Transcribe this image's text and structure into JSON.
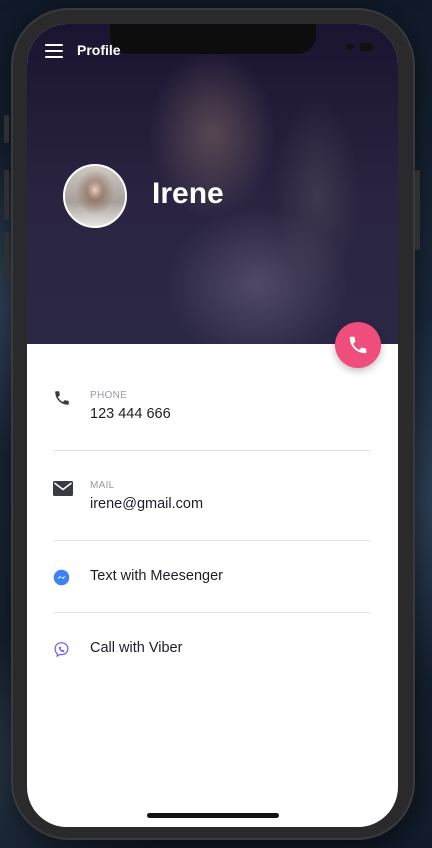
{
  "header": {
    "title": "Profile",
    "name": "Irene"
  },
  "contacts": {
    "phone": {
      "label": "PHONE",
      "value": "123 444 666",
      "icon": "phone-icon"
    },
    "mail": {
      "label": "MAIL",
      "value": "irene@gmail.com",
      "icon": "mail-icon"
    },
    "messenger": {
      "value": "Text with Meesenger",
      "icon": "messenger-icon"
    },
    "viber": {
      "value": "Call with Viber",
      "icon": "viber-icon"
    }
  },
  "colors": {
    "accent": "#ef4d7b",
    "messenger": "#3b82f6",
    "viber": "#7360f2",
    "header_bg": "#241e3a"
  }
}
